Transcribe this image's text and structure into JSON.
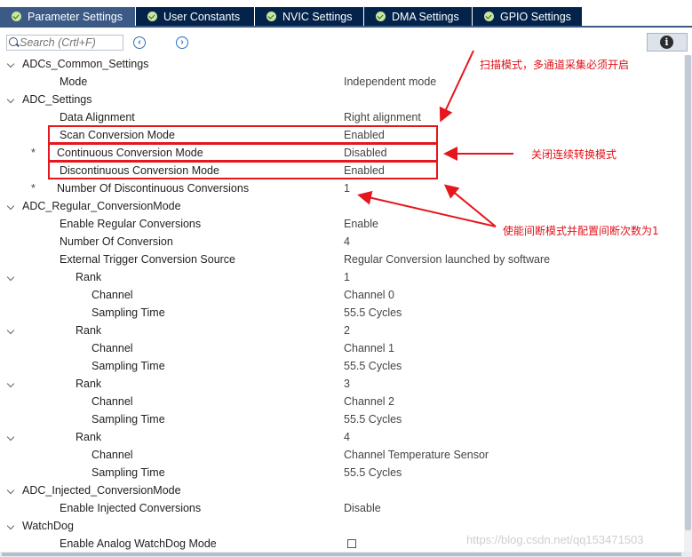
{
  "tabs": [
    {
      "label": "Parameter Settings",
      "active": true
    },
    {
      "label": "User Constants",
      "active": false
    },
    {
      "label": "NVIC Settings",
      "active": false
    },
    {
      "label": "DMA Settings",
      "active": false
    },
    {
      "label": "GPIO Settings",
      "active": false
    }
  ],
  "toolbar": {
    "search_placeholder": "Search (Crtl+F)",
    "prev_icon": "chevron-left-circle-icon",
    "next_icon": "chevron-right-circle-icon",
    "info_icon": "info-icon"
  },
  "tree": [
    {
      "label": "ADCs_Common_Settings",
      "value": "",
      "level": 0,
      "expander": true,
      "star": false
    },
    {
      "label": "Mode",
      "value": "Independent mode",
      "level": 1,
      "expander": false,
      "star": false
    },
    {
      "label": "ADC_Settings",
      "value": "",
      "level": 0,
      "expander": true,
      "star": false
    },
    {
      "label": "Data Alignment",
      "value": "Right alignment",
      "level": 1,
      "expander": false,
      "star": false
    },
    {
      "label": "Scan Conversion Mode",
      "value": "Enabled",
      "level": 1,
      "expander": false,
      "star": false
    },
    {
      "label": "Continuous Conversion Mode",
      "value": "Disabled",
      "level": 1,
      "expander": false,
      "star": true
    },
    {
      "label": "Discontinuous Conversion Mode",
      "value": "Enabled",
      "level": 1,
      "expander": false,
      "star": false
    },
    {
      "label": "Number Of Discontinuous Conversions",
      "value": "1",
      "level": 1,
      "expander": false,
      "star": true
    },
    {
      "label": "ADC_Regular_ConversionMode",
      "value": "",
      "level": 0,
      "expander": true,
      "star": false
    },
    {
      "label": "Enable Regular Conversions",
      "value": "Enable",
      "level": 1,
      "expander": false,
      "star": false
    },
    {
      "label": "Number Of Conversion",
      "value": "4",
      "level": 1,
      "expander": false,
      "star": false
    },
    {
      "label": "External Trigger Conversion Source",
      "value": "Regular Conversion launched by software",
      "level": 1,
      "expander": false,
      "star": false
    },
    {
      "label": "Rank",
      "value": "1",
      "level": 2,
      "expander": true,
      "star": false
    },
    {
      "label": "Channel",
      "value": "Channel 0",
      "level": 3,
      "expander": false,
      "star": false
    },
    {
      "label": "Sampling Time",
      "value": "55.5 Cycles",
      "level": 3,
      "expander": false,
      "star": false
    },
    {
      "label": "Rank",
      "value": "2",
      "level": 2,
      "expander": true,
      "star": false
    },
    {
      "label": "Channel",
      "value": "Channel 1",
      "level": 3,
      "expander": false,
      "star": false
    },
    {
      "label": "Sampling Time",
      "value": "55.5 Cycles",
      "level": 3,
      "expander": false,
      "star": false
    },
    {
      "label": "Rank",
      "value": "3",
      "level": 2,
      "expander": true,
      "star": false
    },
    {
      "label": "Channel",
      "value": "Channel 2",
      "level": 3,
      "expander": false,
      "star": false
    },
    {
      "label": "Sampling Time",
      "value": "55.5 Cycles",
      "level": 3,
      "expander": false,
      "star": false
    },
    {
      "label": "Rank",
      "value": "4",
      "level": 2,
      "expander": true,
      "star": false
    },
    {
      "label": "Channel",
      "value": "Channel Temperature Sensor",
      "level": 3,
      "expander": false,
      "star": false
    },
    {
      "label": "Sampling Time",
      "value": "55.5 Cycles",
      "level": 3,
      "expander": false,
      "star": false
    },
    {
      "label": "ADC_Injected_ConversionMode",
      "value": "",
      "level": 0,
      "expander": true,
      "star": false
    },
    {
      "label": "Enable Injected Conversions",
      "value": "Disable",
      "level": 1,
      "expander": false,
      "star": false
    },
    {
      "label": "WatchDog",
      "value": "",
      "level": 0,
      "expander": true,
      "star": false
    },
    {
      "label": "Enable Analog WatchDog Mode",
      "value": "",
      "level": 1,
      "expander": false,
      "star": false,
      "checkbox": false
    }
  ],
  "annotations": {
    "scan_note": "扫描模式，多通道采集必须开启",
    "continuous_note": "关闭连续转换模式",
    "discontinuous_note": "使能间断模式并配置间断次数为1",
    "color": "#e5161c"
  },
  "watermark": "https://blog.csdn.net/qq153471503",
  "colors": {
    "tab_bg": "#03234b",
    "tab_active_bg": "#3c5a86",
    "check_green": "#c8e6a0"
  }
}
